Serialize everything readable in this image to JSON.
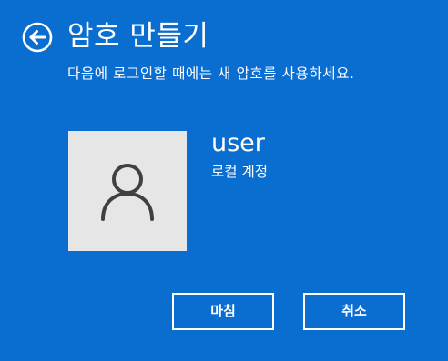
{
  "header": {
    "title": "암호 만들기",
    "back_icon": "back-arrow-circle-icon"
  },
  "instruction": "다음에 로그인할 때에는 새 암호를 사용하세요.",
  "account": {
    "avatar_icon": "person-icon",
    "user_name": "user",
    "account_type": "로컬 계정"
  },
  "buttons": {
    "finish_label": "마침",
    "cancel_label": "취소"
  },
  "colors": {
    "background": "#0a6ed1",
    "avatar_background": "#e6e6e6",
    "avatar_icon": "#404040",
    "text": "#ffffff"
  }
}
